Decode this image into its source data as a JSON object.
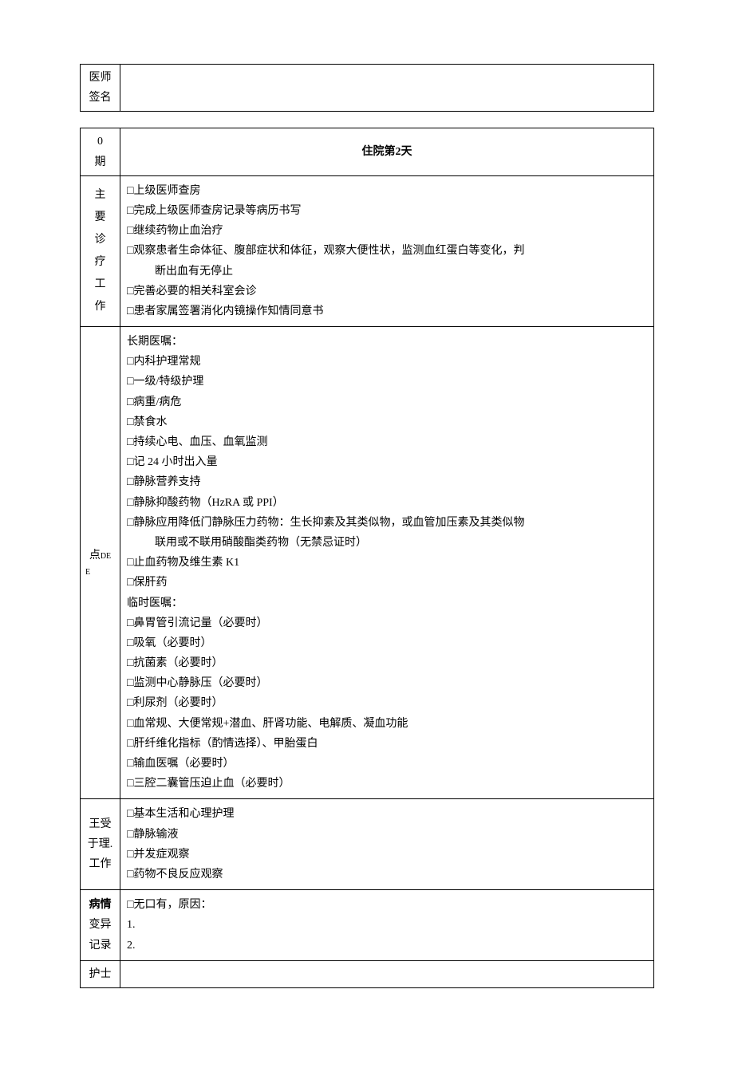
{
  "table1": {
    "row1_label": "医师\n签名"
  },
  "table2": {
    "dateLabel": "0\n期",
    "dayHeader": "住院第",
    "dayNumber": "2",
    "daySuffix": "天",
    "work": {
      "label": "主要诊疗工作",
      "items": [
        "□上级医师查房",
        "□完成上级医师查房记录等病历书写",
        "□继续药物止血治疗",
        "□观察患者生命体征、腹部症状和体征，观察大便性状，监测血红蛋白等变化，判",
        "断出血有无停止",
        "□完善必要的相关科室会诊",
        "□患者家属签署消化内镜操作知情同意书"
      ]
    },
    "orders": {
      "label1": "点",
      "labelSub1": "DE",
      "labelSub2": "E",
      "longTermHeader": "长期医嘱：",
      "longTerm": [
        "□内科护理常规",
        "□一级/特级护理",
        "□病重/病危",
        "□禁食水",
        "□持续心电、血压、血氧监测",
        "□记 24 小时出入量",
        "□静脉营养支持",
        "□静脉抑酸药物（HzRA 或 PPI）",
        "□静脉应用降低门静脉压力药物：生长抑素及其类似物，或血管加压素及其类似物"
      ],
      "longTermIndent": "联用或不联用硝酸酯类药物（无禁忌证时）",
      "longTermCont": [
        "□止血药物及维生素 K1",
        "□保肝药"
      ],
      "tempHeader": "临时医嘱：",
      "temp": [
        "□鼻胃管引流记量（必要时）",
        "□吸氧（必要时）",
        "□抗菌素（必要时）",
        "□监测中心静脉压（必要时）",
        "□利尿剂（必要时）",
        "□血常规、大便常规+潜血、肝肾功能、电解质、凝血功能",
        "□肝纤维化指标（酌情选择）、甲胎蛋白",
        "□输血医嘱（必要时）",
        "□三腔二囊管压迫止血（必要时）"
      ]
    },
    "nursing": {
      "label": "王受\n于理.\n工作",
      "items": [
        "□基本生活和心理护理",
        "□静脉输液",
        "□并发症观察",
        "□药物不良反应观察"
      ]
    },
    "variance": {
      "labelBold": "病情",
      "labelRest": "变异\n记录",
      "items": [
        "□无口有，原因：",
        "1.",
        "2."
      ]
    },
    "nurse": {
      "label": "护士"
    }
  }
}
